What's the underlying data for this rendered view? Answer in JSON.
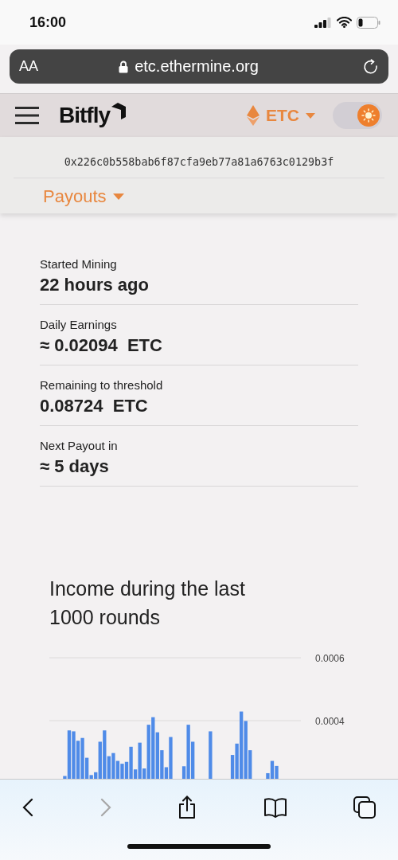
{
  "status_bar": {
    "time": "16:00"
  },
  "browser": {
    "text_size": "AA",
    "url": "etc.ethermine.org",
    "forward_disabled": true
  },
  "header": {
    "brand": "Bitfly",
    "currency": "ETC",
    "light_mode": true
  },
  "miner": {
    "address": "0x226c0b558bab6f87cfa9eb77a81a6763c0129b3f",
    "section": "Payouts"
  },
  "stats": [
    {
      "label": "Started Mining",
      "value": "22 hours ago"
    },
    {
      "label": "Daily Earnings",
      "value": "≈ 0.02094  ETC"
    },
    {
      "label": "Remaining to threshold",
      "value": "0.08724  ETC"
    },
    {
      "label": "Next Payout in",
      "value": "≈ 5 days"
    }
  ],
  "chart": {
    "title": "Income during the last 1000 rounds",
    "chart_data": {
      "type": "bar",
      "ylim": [
        0,
        0.0006
      ],
      "yticks": [
        {
          "value": 0.0004,
          "label": "0.0004"
        },
        {
          "value": 0.0006,
          "label": "0.0006"
        }
      ],
      "series": [
        {
          "color": "#4f8be8",
          "values": [
            null,
            null,
            null,
            0.000224,
            0.000369,
            0.000366,
            0.000336,
            0.000345,
            0.000282,
            0.000227,
            0.000236,
            0.000333,
            0.000369,
            0.000287,
            0.000297,
            0.000272,
            0.000263,
            0.000269,
            0.000317,
            0.000245,
            0.00033,
            0.000248,
            0.000387,
            0.000411,
            0.000363,
            0.000306,
            0.000252,
            0.000348,
            null,
            null,
            0.000255,
            0.000387,
            0.000333,
            null,
            null,
            null,
            0.000366,
            null,
            null,
            null,
            null,
            0.000291,
            0.000327,
            0.000429,
            0.000399,
            0.000306,
            null,
            null,
            null,
            0.000233,
            0.000272,
            0.000256,
            null,
            null,
            null,
            null,
            null
          ]
        }
      ]
    }
  }
}
